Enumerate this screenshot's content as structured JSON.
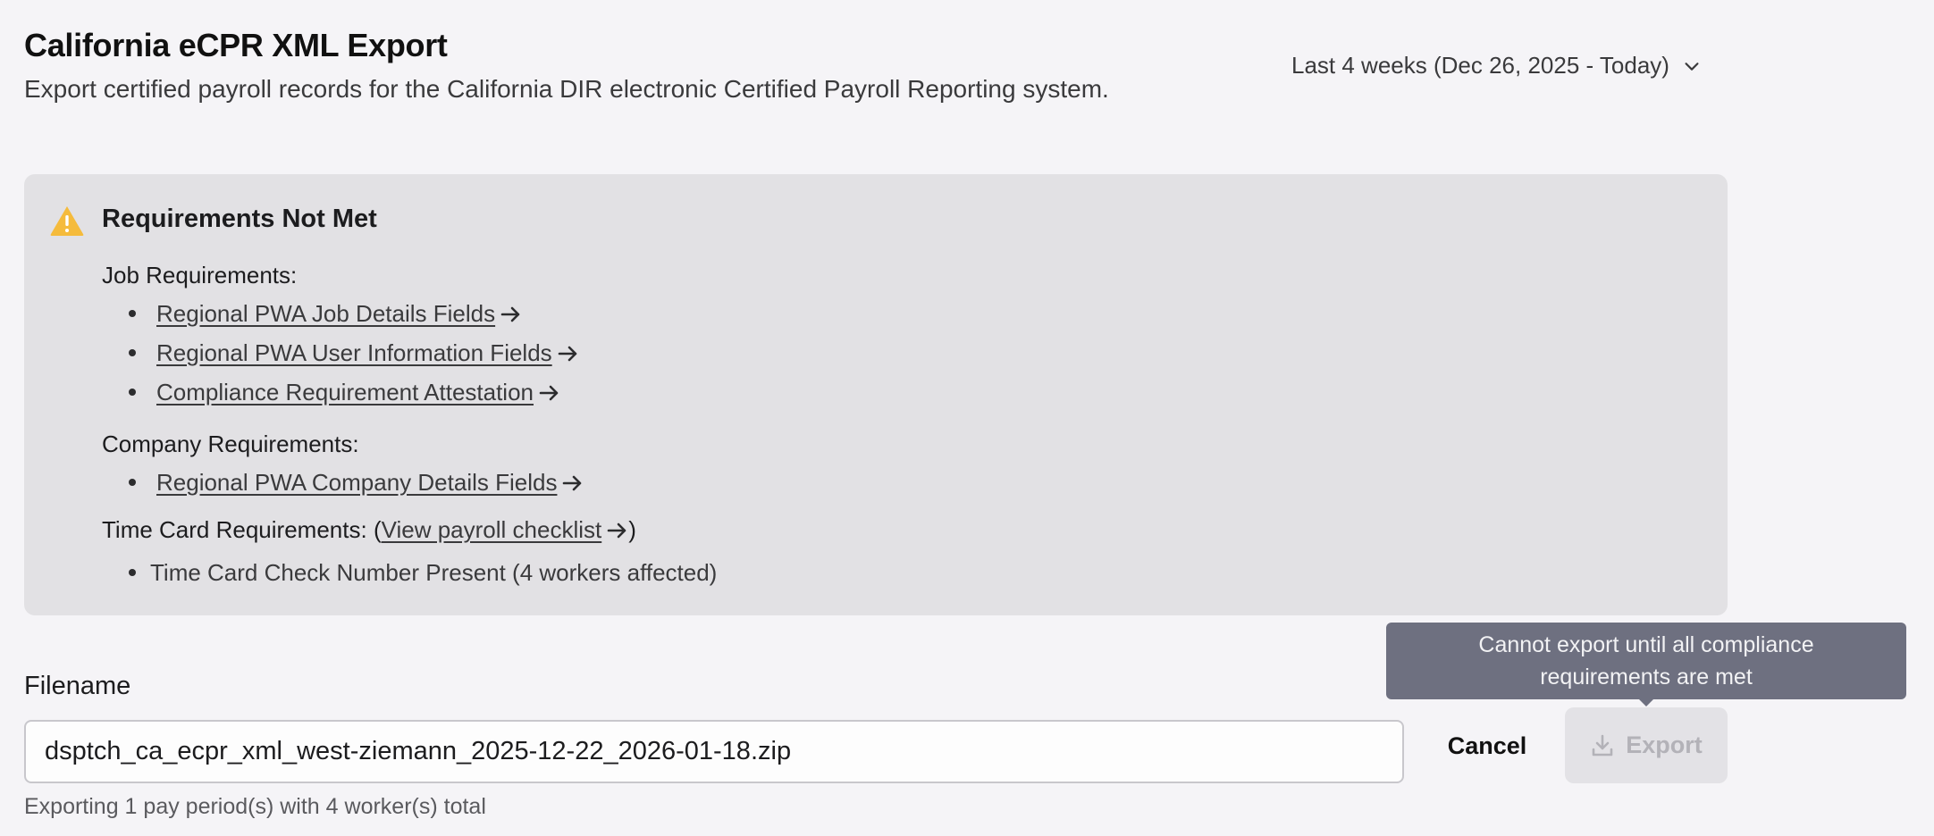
{
  "header": {
    "title": "California eCPR XML Export",
    "subtitle": "Export certified payroll records for the California DIR electronic Certified Payroll Reporting system.",
    "date_range": "Last 4 weeks (Dec 26, 2025 - Today)"
  },
  "alert": {
    "icon": "warning-icon",
    "title": "Requirements Not Met",
    "job_label": "Job Requirements:",
    "job_items": [
      "Regional PWA Job Details Fields",
      "Regional PWA User Information Fields",
      "Compliance Requirement Attestation"
    ],
    "company_label": "Company Requirements:",
    "company_items": [
      "Regional PWA Company Details Fields"
    ],
    "time_card_label": "Time Card Requirements:",
    "time_card_link": "View payroll checklist",
    "time_card_items": [
      "Time Card Check Number Present (4 workers affected)"
    ]
  },
  "form": {
    "filename_label": "Filename",
    "filename_value": "dsptch_ca_ecpr_xml_west-ziemann_2025-12-22_2026-01-18.zip",
    "helper": "Exporting 1 pay period(s) with 4 worker(s) total"
  },
  "actions": {
    "cancel": "Cancel",
    "export": "Export",
    "tooltip_line1": "Cannot export until all compliance",
    "tooltip_line2": "requirements are met"
  },
  "colors": {
    "warning": "#f5bb3c",
    "alert_bg": "#e2e1e4",
    "tooltip_bg": "#6e7080"
  }
}
